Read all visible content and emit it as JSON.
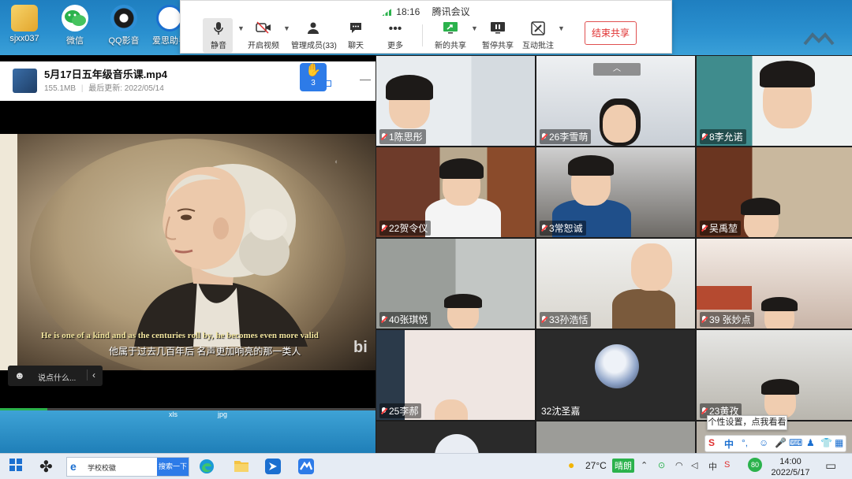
{
  "desktop": {
    "icons": [
      {
        "label": "sjxx037"
      },
      {
        "label": "微信"
      },
      {
        "label": "QQ影音"
      },
      {
        "label": "爱思助手"
      }
    ]
  },
  "meeting_toolbar": {
    "time": "18:16",
    "app_name": "腾讯会议",
    "buttons": {
      "mute": "静音",
      "video": "开启视频",
      "members": "管理成员(33)",
      "chat": "聊天",
      "more": "更多",
      "new_share": "新的共享",
      "pause_share": "暂停共享",
      "annotate": "互动批注"
    },
    "end_share": "结束共享"
  },
  "file": {
    "title": "5月17日五年级音乐课.mp4",
    "size": "155.1MB",
    "updated": "最后更新: 2022/05/14",
    "hands_raised": "3"
  },
  "video": {
    "subtitle_en": "He is one of a kind and as the centuries roll by, he becomes even more valid",
    "subtitle_zh": "他属于过去几百年后 名声更加响亮的那一类人",
    "watermark": "bi",
    "progress": 0.125
  },
  "chat": {
    "placeholder": "说点什么..."
  },
  "strip": {
    "label_a": "xls",
    "label_b": "jpg"
  },
  "participants": [
    {
      "name": "1陈思彤"
    },
    {
      "name": "26李雪萌"
    },
    {
      "name": "8李允诺"
    },
    {
      "name": "22贺令仪"
    },
    {
      "name": "3常恕诚"
    },
    {
      "name": "吴禹堃"
    },
    {
      "name": "40张琪悦"
    },
    {
      "name": "33孙浩恬"
    },
    {
      "name": "39 张妙点"
    },
    {
      "name": "25李郝"
    },
    {
      "name": "32沈圣嘉"
    },
    {
      "name": "23黄孜"
    }
  ],
  "tooltip": "个性设置，点我看看",
  "ime": {
    "mode": "中"
  },
  "taskbar": {
    "search_text": "学校校徽",
    "search_button": "搜索一下",
    "temperature": "27°C",
    "weather_text": "晴朗",
    "badge": "80",
    "time": "14:00",
    "date": "2022/5/17"
  }
}
